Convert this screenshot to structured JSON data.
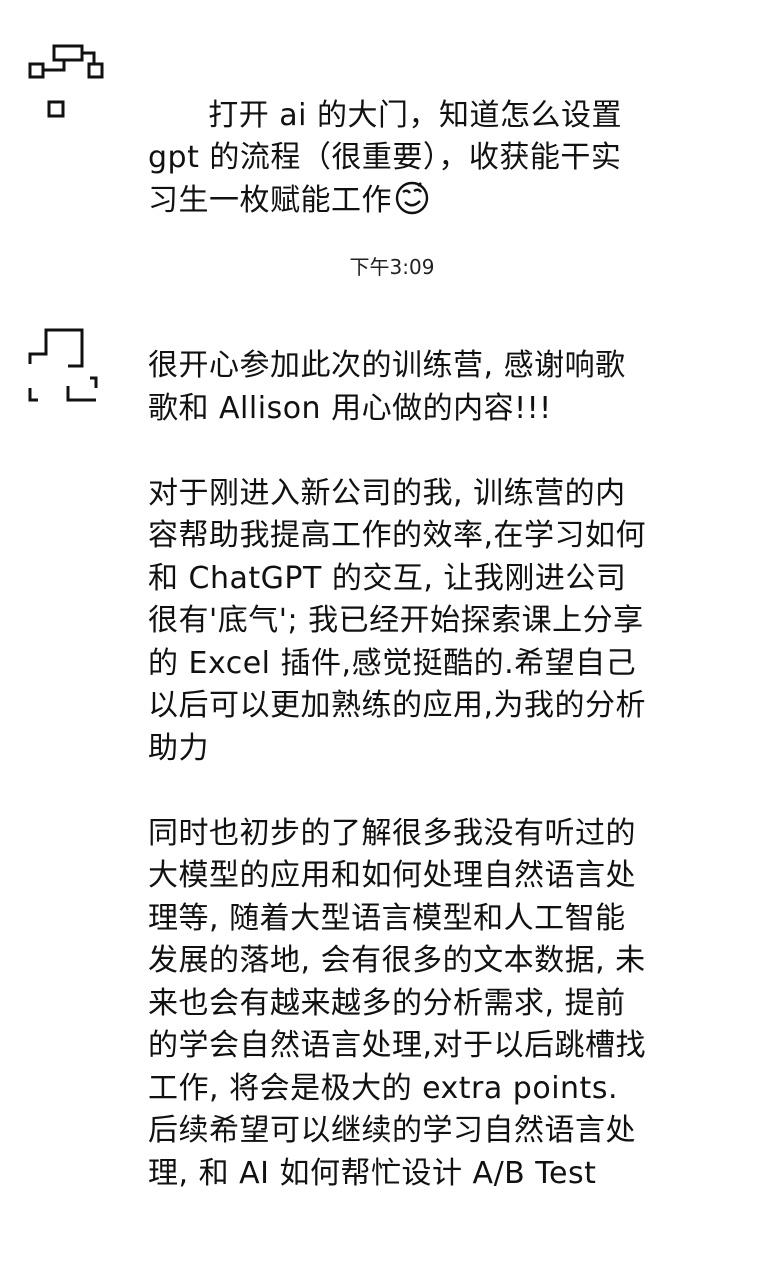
{
  "conversation": {
    "messages": [
      {
        "text": "打开 ai 的大门，知道怎么设置 gpt 的流程（很重要），收获能干实习生一枚赋能工作",
        "trailing_icon": "smiling-face-emoji-icon",
        "avatar_icon": "pixelated-avatar-icon"
      },
      {
        "text": "很开心参加此次的训练营, 感谢响歌歌和 Allison 用心做的内容!!!\n\n对于刚进入新公司的我, 训练营的内容帮助我提高工作的效率,在学习如何和 ChatGPT 的交互, 让我刚进公司很有'底气'; 我已经开始探索课上分享的 Excel 插件,感觉挺酷的.希望自己以后可以更加熟练的应用,为我的分析助力\n\n同时也初步的了解很多我没有听过的大模型的应用和如何处理自然语言处理等, 随着大型语言模型和人工智能发展的落地, 会有很多的文本数据, 未来也会有越来越多的分析需求, 提前的学会自然语言处理,对于以后跳槽找工作, 将会是极大的 extra points.  后续希望可以继续的学习自然语言处理, 和 AI 如何帮忙设计 A/B Test",
        "avatar_icon": "pixelated-avatar-icon"
      }
    ],
    "timestamp": "下午3:09"
  }
}
